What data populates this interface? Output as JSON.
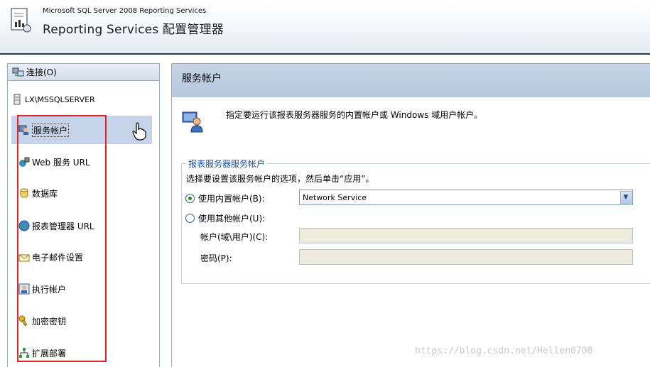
{
  "header": {
    "subtitle": "Microsoft SQL Server 2008 Reporting Services",
    "title": "Reporting Services 配置管理器"
  },
  "left": {
    "connect_label": "连接(O)",
    "server": "LX\\MSSQLSERVER",
    "nav": [
      {
        "label": "服务帐户",
        "icon": "service-account-icon"
      },
      {
        "label": "Web 服务 URL",
        "icon": "web-service-icon"
      },
      {
        "label": "数据库",
        "icon": "database-icon"
      },
      {
        "label": "报表管理器 URL",
        "icon": "globe-icon"
      },
      {
        "label": "电子邮件设置",
        "icon": "email-icon"
      },
      {
        "label": "执行帐户",
        "icon": "execution-account-icon"
      },
      {
        "label": "加密密钥",
        "icon": "key-icon"
      },
      {
        "label": "扩展部署",
        "icon": "scale-out-icon"
      }
    ],
    "selected_index": 0
  },
  "right": {
    "title": "服务帐户",
    "description": "指定要运行该报表服务器服务的内置帐户或 Windows 域用户帐户。",
    "group_title": "报表服务器服务帐户",
    "group_hint": "选择要设置该服务帐户的选项，然后单击“应用”。",
    "builtin_label": "使用内置帐户(B):",
    "builtin_value": "Network Service",
    "other_label": "使用其他帐户(U):",
    "account_label": "帐户(域\\用户)(C):",
    "password_label": "密码(P):",
    "selected_option": "builtin"
  },
  "watermark": "https://blog.csdn.net/Hellen0708",
  "colors": {
    "highlight_box": "#e0262a",
    "selected_item": "#c5d4e8",
    "legend_text": "#1b4fa5"
  }
}
